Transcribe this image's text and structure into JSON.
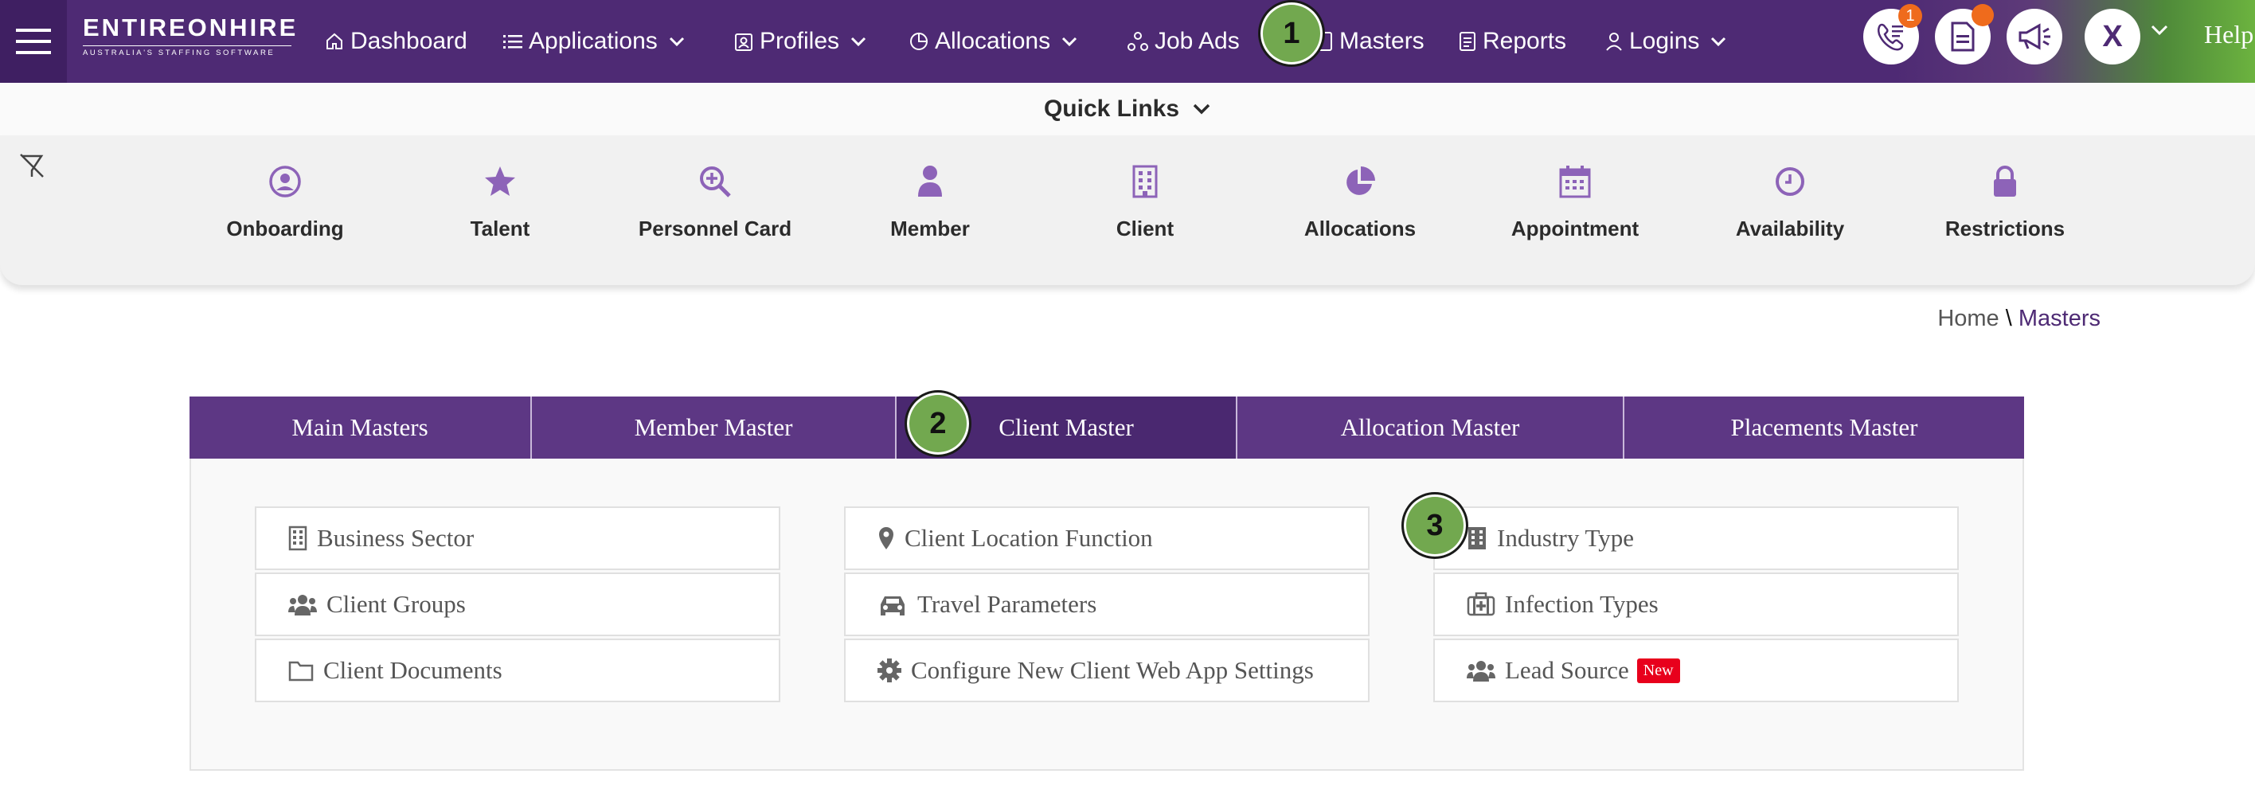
{
  "brand": {
    "logo_main": "ENTIREONHIRE",
    "logo_sub": "AUSTRALIA'S STAFFING SOFTWARE"
  },
  "nav": {
    "items": [
      {
        "label": "Dashboard",
        "icon": "home-icon"
      },
      {
        "label": "Applications",
        "icon": "list-icon",
        "dropdown": true
      },
      {
        "label": "Profiles",
        "icon": "profile-icon",
        "dropdown": true
      },
      {
        "label": "Allocations",
        "icon": "pie-icon",
        "dropdown": true
      },
      {
        "label": "Job Ads",
        "icon": "network-icon"
      },
      {
        "label": "Masters",
        "icon": "document-icon"
      },
      {
        "label": "Reports",
        "icon": "report-icon"
      },
      {
        "label": "Logins",
        "icon": "user-icon",
        "dropdown": true
      }
    ],
    "phone_badge": "1",
    "avatar_letter": "X",
    "help": "Help"
  },
  "steps": [
    "1",
    "2",
    "3"
  ],
  "quick_links": {
    "title": "Quick Links",
    "items": [
      {
        "label": "Onboarding",
        "icon": "user-circle-icon"
      },
      {
        "label": "Talent",
        "icon": "star-icon"
      },
      {
        "label": "Personnel Card",
        "icon": "search-plus-icon"
      },
      {
        "label": "Member",
        "icon": "person-icon"
      },
      {
        "label": "Client",
        "icon": "building-icon"
      },
      {
        "label": "Allocations",
        "icon": "pie-chart-icon"
      },
      {
        "label": "Appointment",
        "icon": "calendar-icon"
      },
      {
        "label": "Availability",
        "icon": "clock-icon"
      },
      {
        "label": "Restrictions",
        "icon": "lock-icon"
      }
    ]
  },
  "breadcrumb": {
    "home": "Home",
    "separator": "\\",
    "current": "Masters"
  },
  "tabs": [
    {
      "label": "Main Masters",
      "active": false
    },
    {
      "label": "Member Master",
      "active": false
    },
    {
      "label": "Client Master",
      "active": true
    },
    {
      "label": "Allocation Master",
      "active": false
    },
    {
      "label": "Placements Master",
      "active": false
    }
  ],
  "client_master": {
    "items": [
      {
        "label": "Business Sector",
        "icon": "building-icon"
      },
      {
        "label": "Client Location Function",
        "icon": "map-marker-icon"
      },
      {
        "label": "Industry Type",
        "icon": "industry-building-icon"
      },
      {
        "label": "Client Groups",
        "icon": "users-icon"
      },
      {
        "label": "Travel Parameters",
        "icon": "car-icon"
      },
      {
        "label": "Infection Types",
        "icon": "medkit-icon"
      },
      {
        "label": "Client Documents",
        "icon": "folder-icon"
      },
      {
        "label": "Configure New Client Web App Settings",
        "icon": "gear-icon"
      },
      {
        "label": "Lead Source",
        "icon": "users-icon",
        "badge": "New"
      }
    ]
  },
  "colors": {
    "primary": "#4e2a74",
    "tab_bg": "#5d3784",
    "accent_green": "#6cb33f",
    "icon_purple": "#8d63b8",
    "badge_orange": "#ef6b1c",
    "new_red": "#e8001c"
  }
}
